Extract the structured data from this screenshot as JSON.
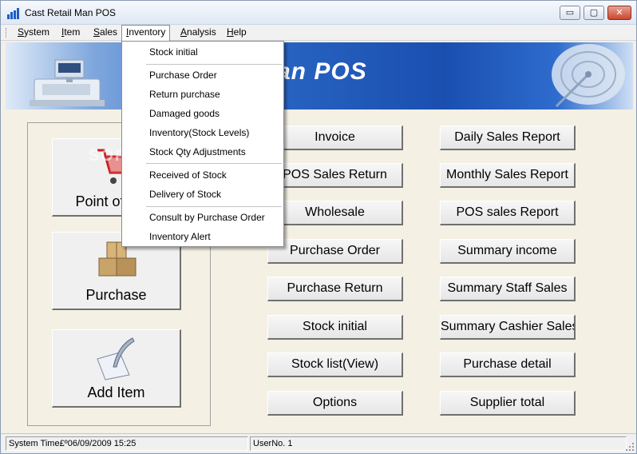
{
  "window": {
    "title": "Cast Retail Man POS",
    "controls": {
      "minimize": "▭",
      "maximize": "▢",
      "close": "✕"
    }
  },
  "menubar": {
    "items": [
      {
        "label": "System",
        "underline": "S",
        "rest": "ystem"
      },
      {
        "label": "Item",
        "underline": "I",
        "rest": "tem"
      },
      {
        "label": "Sales",
        "underline": "S",
        "rest": "ales"
      },
      {
        "label": "Inventory",
        "underline": "I",
        "rest": "nventory",
        "active": true
      },
      {
        "label": "Analysis",
        "underline": "A",
        "rest": "nalysis"
      },
      {
        "label": "Help",
        "underline": "H",
        "rest": "elp"
      }
    ]
  },
  "banner": {
    "title": "an POS"
  },
  "inventory_menu": {
    "items": [
      "Stock initial",
      "Purchase Order",
      "Return purchase",
      "Damaged goods",
      "Inventory(Stock Levels)",
      "Stock Qty Adjustments",
      "Received of Stock",
      "Delivery of Stock",
      "Consult by Purchase Order",
      "Inventory Alert"
    ]
  },
  "left_buttons": {
    "point_of_sale": "Point of Sale",
    "purchase": "Purchase",
    "add_item": "Add Item"
  },
  "watermark": "SOFTPEDIA",
  "function_buttons": {
    "column1": [
      "Invoice",
      "POS Sales Return",
      "Wholesale",
      "Purchase Order",
      "Purchase Return",
      "Stock initial",
      "Stock list(View)",
      "Options"
    ],
    "column2": [
      "Daily Sales Report",
      "Monthly Sales Report",
      "POS sales Report",
      "Summary income",
      "Summary Staff Sales",
      "Summary Cashier Sales",
      "Purchase detail",
      "Supplier total"
    ]
  },
  "statusbar": {
    "system_time": "System Time£º06/09/2009 15:25",
    "user_no": "UserNo. 1"
  },
  "colors": {
    "banner_blue": "#1a4fb0",
    "window_bg": "#f4f0e4",
    "close_red": "#c9472e"
  }
}
